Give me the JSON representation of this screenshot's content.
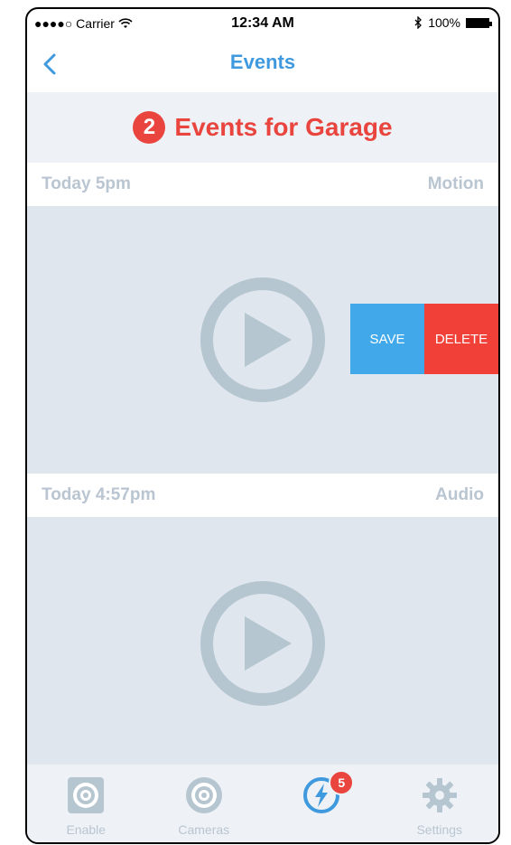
{
  "status_bar": {
    "carrier": "●●●●○ Carrier",
    "time": "12:34 AM",
    "battery": "100%"
  },
  "nav": {
    "title": "Events"
  },
  "header": {
    "step": "2",
    "title": "Events for Garage"
  },
  "events": [
    {
      "time": "Today 5pm",
      "type": "Motion"
    },
    {
      "time": "Today 4:57pm",
      "type": "Audio"
    }
  ],
  "swipe_actions": {
    "save": "SAVE",
    "delete": "DELETE"
  },
  "tabbar": {
    "items": [
      {
        "label": "Enable"
      },
      {
        "label": "Cameras"
      },
      {
        "label": "",
        "badge": "5"
      },
      {
        "label": "Settings"
      }
    ]
  },
  "colors": {
    "accent": "#3f99de",
    "alert": "#e9453e",
    "save": "#41a9ea",
    "delete": "#f04038"
  }
}
